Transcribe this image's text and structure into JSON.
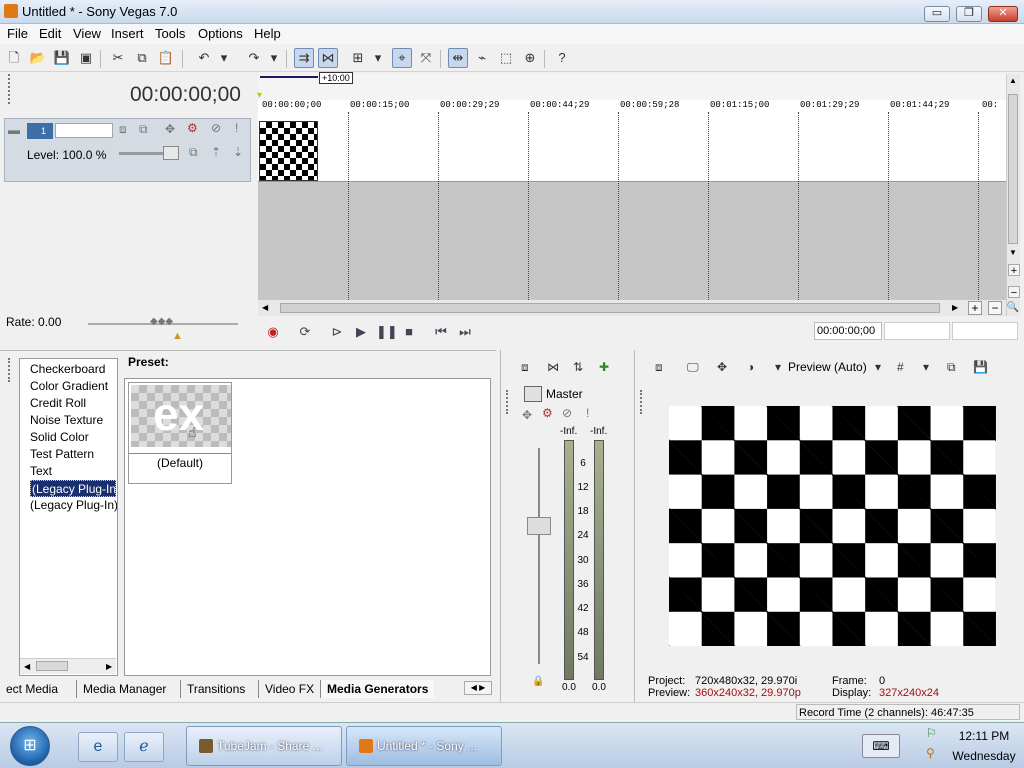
{
  "window": {
    "title": "Untitled * - Sony Vegas 7.0",
    "minimize": "▭",
    "maximize": "❐",
    "close": "✕"
  },
  "menu": [
    "File",
    "Edit",
    "View",
    "Insert",
    "Tools",
    "Options",
    "Help"
  ],
  "toolbar": {
    "icons": [
      "new-icon",
      "open-icon",
      "save-icon",
      "save-as-icon",
      "cut-icon",
      "copy-icon",
      "paste-icon",
      "undo-icon",
      "redo-icon",
      "auto-ripple-icon",
      "ignore-event-grouping-icon",
      "lock-envelopes-icon",
      "snapping-icon",
      "auto-crossfade-icon",
      "normal-edit-tool-icon",
      "envelope-tool-icon",
      "selection-tool-icon",
      "zoom-tool-icon",
      "help-icon"
    ]
  },
  "timeline": {
    "timecode": "00:00:00;00",
    "marker": "+10:00",
    "ticks": [
      "00:00:00;00",
      "00:00:15;00",
      "00:00:29;29",
      "00:00:44;29",
      "00:00:59;28",
      "00:01:15;00",
      "00:01:29;29",
      "00:01:44;29",
      "00:"
    ],
    "track": {
      "number": "1",
      "level_label": "Level: 100.0 %"
    },
    "rate": "Rate: 0.00",
    "transport_timecode": "00:00:00;00"
  },
  "generators": {
    "preset_label": "Preset:",
    "list": [
      "Checkerboard",
      "Color Gradient",
      "Credit Roll",
      "Noise Texture",
      "Solid Color",
      "Test Pattern",
      "Text",
      "(Legacy Plug-In) T",
      "(Legacy Plug-In) V"
    ],
    "selected_index": 7,
    "preset_thumb_text": "ex",
    "preset_name": "(Default)",
    "tabs": [
      "ect Media",
      "Media Manager",
      "Transitions",
      "Video FX",
      "Media Generators"
    ],
    "active_tab": "Media Generators"
  },
  "mixer": {
    "master_label": "Master",
    "inf_left": "-Inf.",
    "inf_right": "-Inf.",
    "scale": [
      "6",
      "12",
      "18",
      "24",
      "30",
      "36",
      "42",
      "48",
      "54"
    ],
    "zero_left": "0.0",
    "zero_right": "0.0"
  },
  "preview": {
    "mode": "Preview (Auto)",
    "project_label": "Project:",
    "project_value": "720x480x32, 29.970i",
    "preview_label": "Preview:",
    "preview_value": "360x240x32, 29.970p",
    "frame_label": "Frame:",
    "frame_value": "0",
    "display_label": "Display:",
    "display_value": "327x240x24"
  },
  "status": {
    "record_time": "Record Time (2 channels): 46:47:35"
  },
  "taskbar": {
    "tasks": [
      "TubeJam - Share ...",
      "Untitled * - Sony ..."
    ],
    "time": "12:11 PM",
    "day": "Wednesday"
  }
}
